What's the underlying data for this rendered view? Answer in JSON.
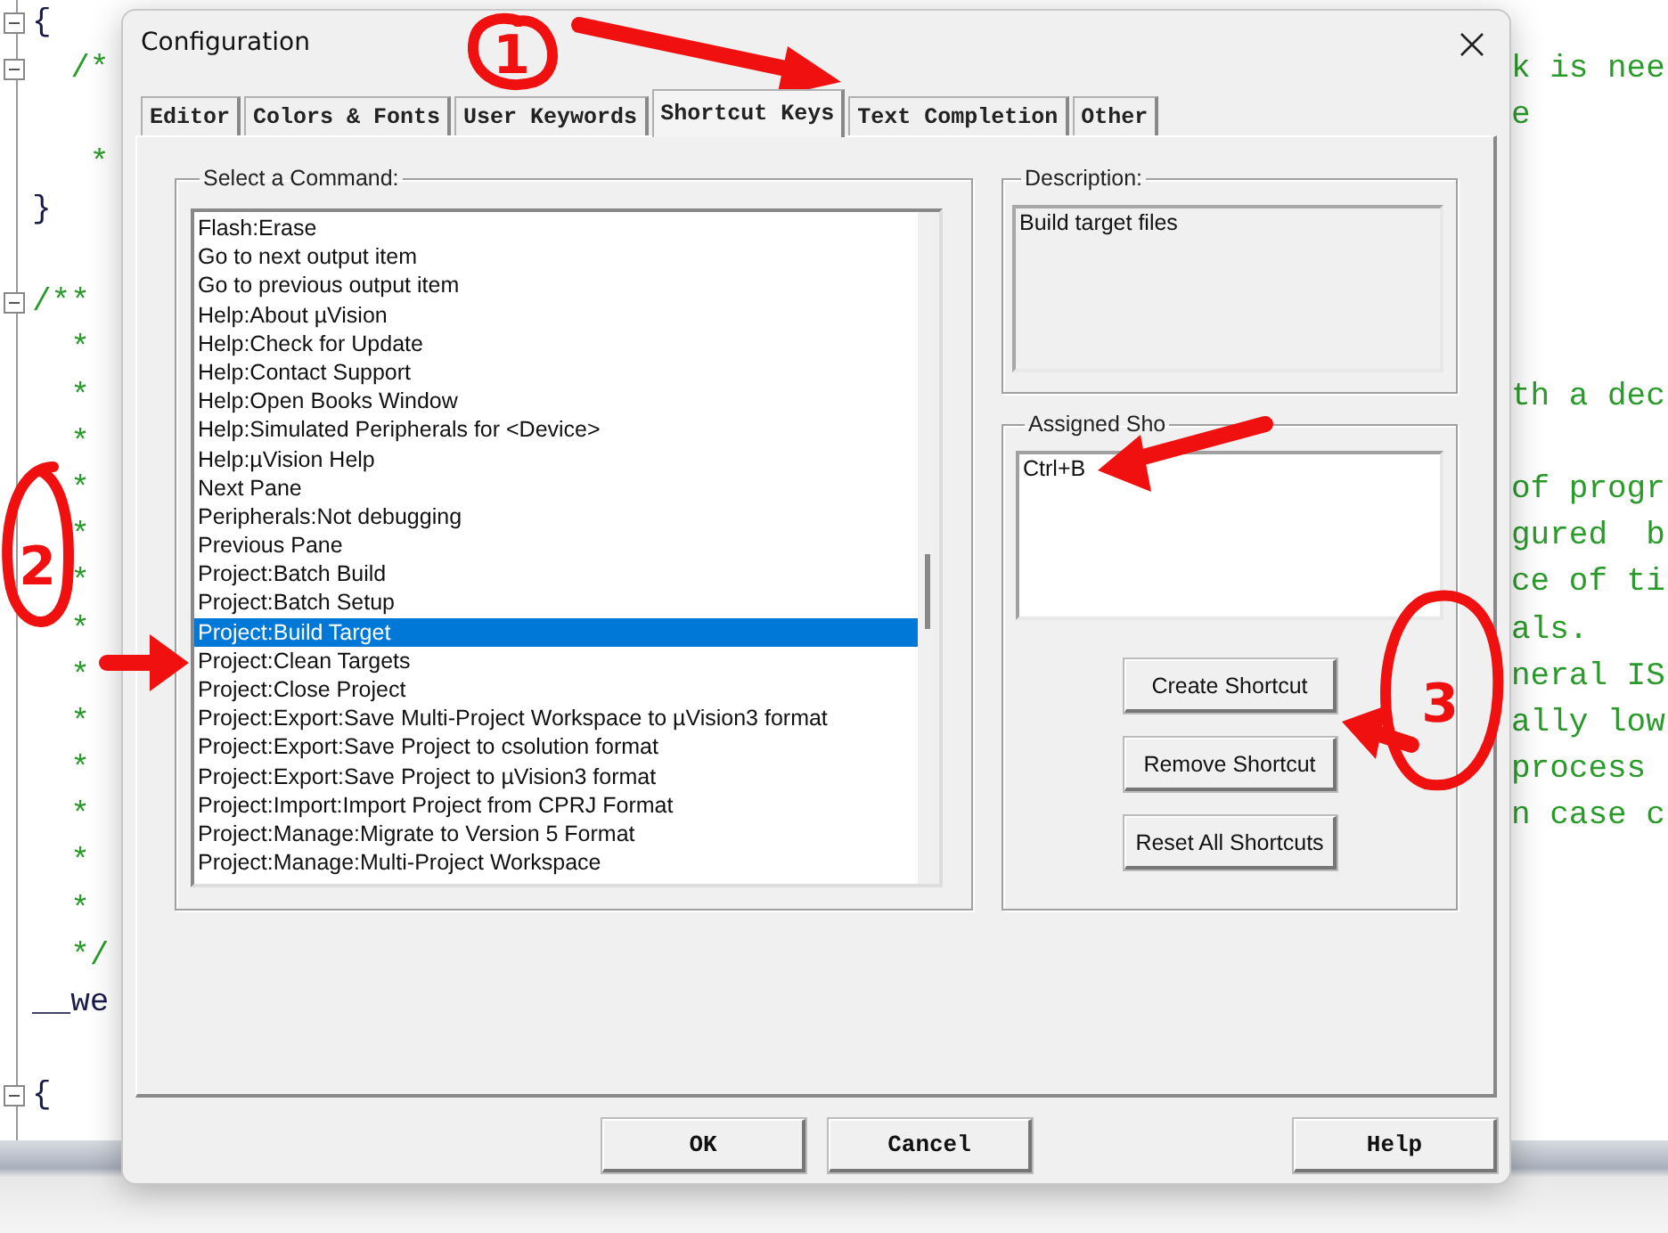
{
  "editor": {
    "lines": [
      {
        "left": "{",
        "kind": "code",
        "fold": true
      },
      {
        "left": "  /*",
        "kind": "comment",
        "fold": true,
        "right": "k is nee"
      },
      {
        "right": "e"
      },
      {
        "left": "   *",
        "kind": "comment"
      },
      {
        "left": "}",
        "kind": "code"
      },
      {
        "kind": "blank"
      },
      {
        "left": "/**",
        "kind": "comment",
        "fold": true
      },
      {
        "left": "  *",
        "kind": "comment"
      },
      {
        "left": "  *",
        "kind": "comment",
        "right": "th a dec"
      },
      {
        "left": "  *",
        "kind": "comment"
      },
      {
        "left": "  *",
        "kind": "comment",
        "right": "of progr"
      },
      {
        "left": "  *",
        "kind": "comment",
        "right": "gured  b"
      },
      {
        "left": "  *",
        "kind": "comment",
        "right": "ce of ti"
      },
      {
        "left": "  *",
        "kind": "comment",
        "right": "als."
      },
      {
        "left": "  *",
        "kind": "comment",
        "right": "neral IS"
      },
      {
        "left": "  *",
        "kind": "comment",
        "right": "ally low"
      },
      {
        "left": "  *",
        "kind": "comment",
        "right": "process"
      },
      {
        "left": "  *",
        "kind": "comment",
        "right": "n case c"
      },
      {
        "left": "  *",
        "kind": "comment"
      },
      {
        "left": "  *",
        "kind": "comment"
      },
      {
        "left": "  */",
        "kind": "comment"
      },
      {
        "left": "__we",
        "kind": "code"
      },
      {
        "kind": "blank"
      },
      {
        "left": "{",
        "kind": "code",
        "fold": true
      }
    ]
  },
  "dialog": {
    "title": "Configuration",
    "tabs": [
      {
        "label": "Editor",
        "selected": false
      },
      {
        "label": "Colors & Fonts",
        "selected": false
      },
      {
        "label": "User Keywords",
        "selected": false
      },
      {
        "label": "Shortcut Keys",
        "selected": true
      },
      {
        "label": "Text Completion",
        "selected": false
      },
      {
        "label": "Other",
        "selected": false
      }
    ],
    "command_group": {
      "label": "Select a Command:",
      "items": [
        {
          "label": "Flash:Erase",
          "selected": false
        },
        {
          "label": "Go to next output item",
          "selected": false
        },
        {
          "label": "Go to previous output item",
          "selected": false
        },
        {
          "label": "Help:About µVision",
          "selected": false
        },
        {
          "label": "Help:Check for Update",
          "selected": false
        },
        {
          "label": "Help:Contact Support",
          "selected": false
        },
        {
          "label": "Help:Open Books Window",
          "selected": false
        },
        {
          "label": "Help:Simulated Peripherals for <Device>",
          "selected": false
        },
        {
          "label": "Help:µVision Help",
          "selected": false
        },
        {
          "label": "Next Pane",
          "selected": false
        },
        {
          "label": "Peripherals:Not debugging",
          "selected": false
        },
        {
          "label": "Previous Pane",
          "selected": false
        },
        {
          "label": "Project:Batch Build",
          "selected": false
        },
        {
          "label": "Project:Batch Setup",
          "selected": false
        },
        {
          "label": "Project:Build Target",
          "selected": true
        },
        {
          "label": "Project:Clean Targets",
          "selected": false
        },
        {
          "label": "Project:Close Project",
          "selected": false
        },
        {
          "label": "Project:Export:Save Multi-Project Workspace to µVision3 format",
          "selected": false
        },
        {
          "label": "Project:Export:Save Project to csolution format",
          "selected": false
        },
        {
          "label": "Project:Export:Save Project to µVision3 format",
          "selected": false
        },
        {
          "label": "Project:Import:Import Project from CPRJ Format",
          "selected": false
        },
        {
          "label": "Project:Manage:Migrate to Version 5 Format",
          "selected": false
        },
        {
          "label": "Project:Manage:Multi-Project Workspace",
          "selected": false
        }
      ]
    },
    "description": {
      "label": "Description:",
      "text": "Build target files"
    },
    "assigned": {
      "label": "Assigned Sho",
      "items": [
        "Ctrl+B"
      ],
      "buttons": [
        "Create Shortcut",
        "Remove Shortcut",
        "Reset All Shortcuts"
      ]
    },
    "buttons": [
      {
        "label": "OK",
        "kind": "left"
      },
      {
        "label": "Cancel",
        "kind": "left"
      },
      {
        "label": "Help",
        "kind": "right"
      }
    ]
  },
  "annotations": [
    {
      "kind": "circled",
      "label": "1"
    },
    {
      "kind": "arrow"
    },
    {
      "kind": "circled",
      "label": "2"
    },
    {
      "kind": "circled",
      "label": "3"
    }
  ]
}
